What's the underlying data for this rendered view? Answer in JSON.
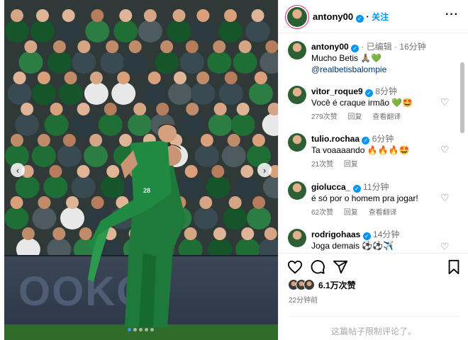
{
  "post": {
    "username": "antony00",
    "follow_label": "关注",
    "more_label": "···"
  },
  "caption": {
    "username": "antony00",
    "edited": "· 已编辑 ·",
    "time": "16分钟",
    "text": "Mucho Betis 🙏🏽💚",
    "mention": "@realbetisbalompie"
  },
  "comments": [
    {
      "username": "vitor_roque9",
      "verified": true,
      "time": "8分钟",
      "text": "Você é craque irmão 💚🤩",
      "likes": "279次赞",
      "reply": "回复",
      "translate": "查看翻译"
    },
    {
      "username": "tulio.rochaa",
      "verified": true,
      "time": "6分钟",
      "text": "Ta voaaaando 🔥🔥🔥🤩",
      "likes": "21次赞",
      "reply": "回复",
      "translate": ""
    },
    {
      "username": "giolucca_",
      "verified": true,
      "time": "11分钟",
      "text": "é só por o homem pra jogar!",
      "likes": "62次赞",
      "reply": "回复",
      "translate": "查看翻译"
    },
    {
      "username": "rodrigohaas",
      "verified": true,
      "time": "14分钟",
      "text": "Joga demais ⚽⚽✈️",
      "likes": "",
      "reply": "",
      "translate": ""
    }
  ],
  "footer": {
    "likes": "6.1万次赞",
    "posted_time": "22分钟前",
    "comments_limited": "这篇帖子限制评论了。"
  },
  "photo": {
    "board_text": "OOKG",
    "carousel_dots": 5,
    "active_dot": 0
  },
  "icons": {
    "like": "heart-icon",
    "comment": "comment-icon",
    "share": "share-icon",
    "save": "bookmark-icon"
  },
  "colors": {
    "link": "#0095f6",
    "verified": "#0095f6",
    "secondary_text": "#737373"
  }
}
